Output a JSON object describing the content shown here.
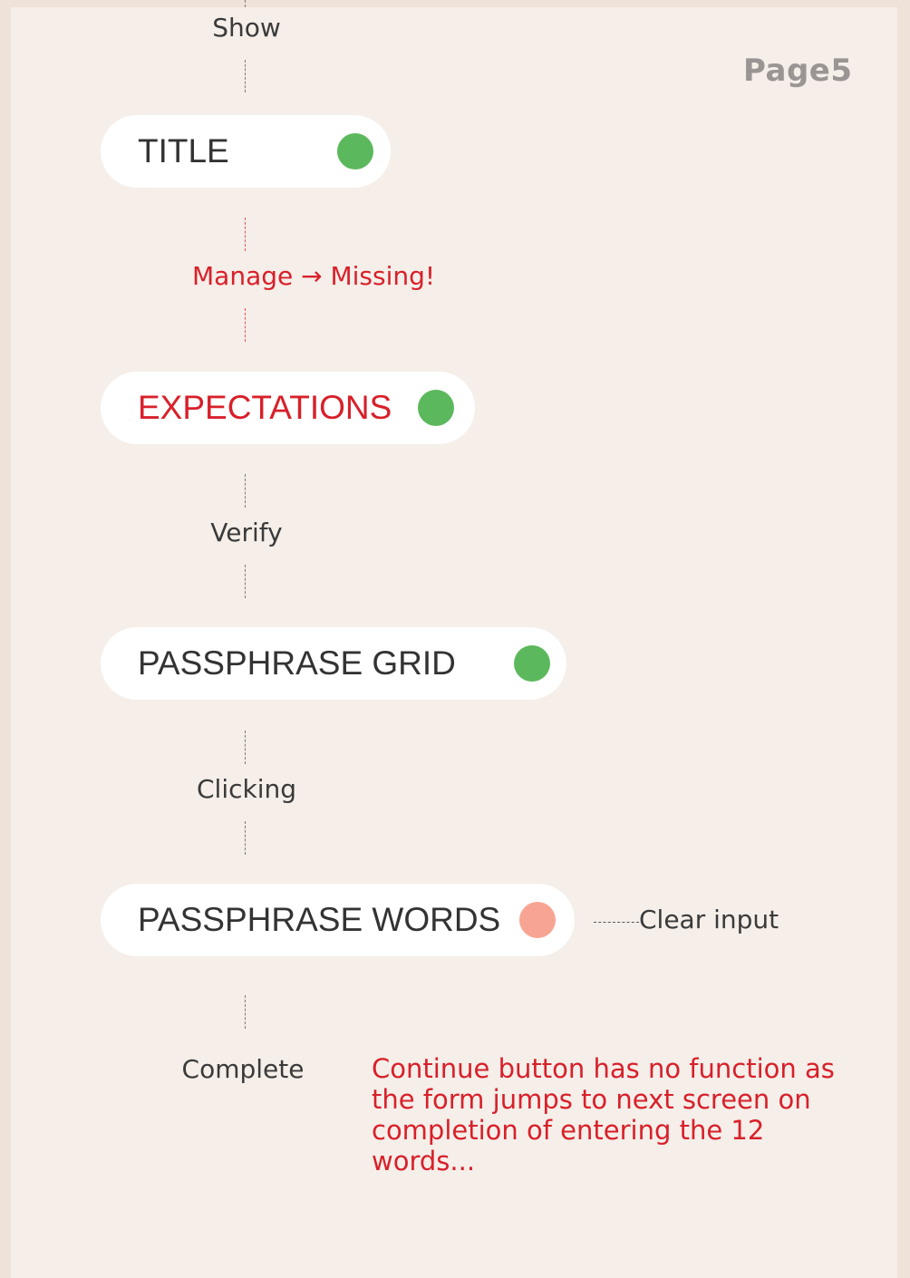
{
  "page": {
    "label": "Page5"
  },
  "colors": {
    "status_ok": "#5cb85c",
    "status_warn": "#f7a592",
    "alert_text": "#d8202a"
  },
  "connectors": {
    "show": "Show",
    "manage": "Manage → Missing!",
    "verify": "Verify",
    "clicking": "Clicking",
    "complete": "Complete"
  },
  "nodes": [
    {
      "title": "TITLE",
      "status": "ok"
    },
    {
      "title": "EXPECTATIONS",
      "status": "ok"
    },
    {
      "title": "PASSPHRASE GRID",
      "status": "ok"
    },
    {
      "title": "PASSPHRASE WORDS",
      "status": "warn",
      "side_label": "Clear input"
    }
  ],
  "note": "Continue button has no function as the form jumps to next screen on completion of entering the 12 words..."
}
